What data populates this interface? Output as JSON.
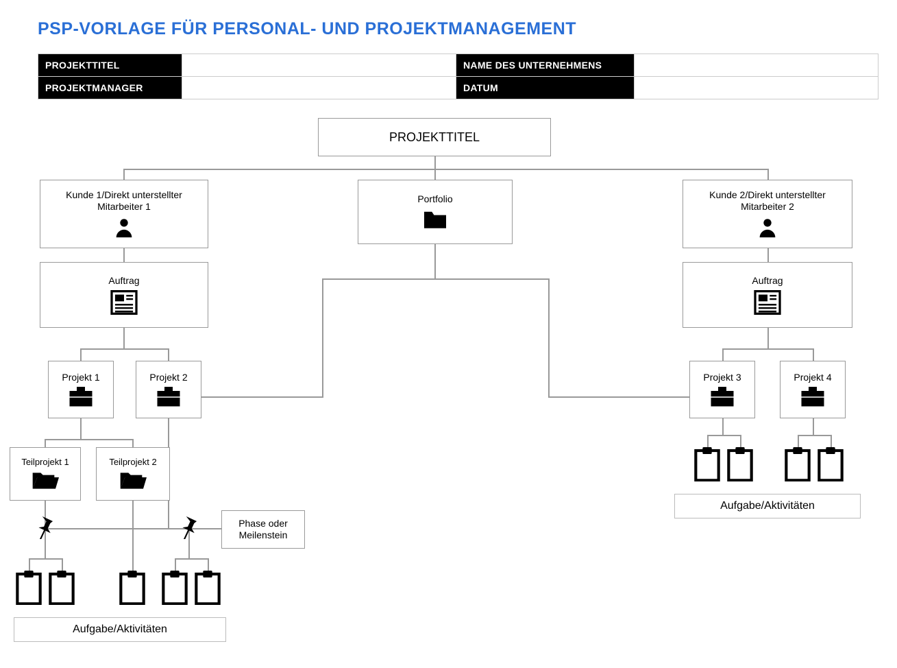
{
  "title": "PSP-VORLAGE FÜR PERSONAL- UND PROJEKTMANAGEMENT",
  "header": {
    "project_title_label": "PROJEKTTITEL",
    "project_title_value": "",
    "company_label": "NAME DES UNTERNEHMENS",
    "company_value": "",
    "manager_label": "PROJEKTMANAGER",
    "manager_value": "",
    "date_label": "DATUM",
    "date_value": ""
  },
  "nodes": {
    "root": "PROJEKTTITEL",
    "cust1": "Kunde 1/Direkt unterstellter Mitarbeiter 1",
    "portfolio": "Portfolio",
    "cust2": "Kunde 2/Direkt unterstellter Mitarbeiter 2",
    "order_left": "Auftrag",
    "order_right": "Auftrag",
    "proj1": "Projekt 1",
    "proj2": "Projekt 2",
    "proj3": "Projekt 3",
    "proj4": "Projekt 4",
    "sub1": "Teilprojekt 1",
    "sub2": "Teilprojekt 2",
    "phase": "Phase oder Meilenstein"
  },
  "captions": {
    "tasks_left": "Aufgabe/Aktivitäten",
    "tasks_right": "Aufgabe/Aktivitäten"
  }
}
